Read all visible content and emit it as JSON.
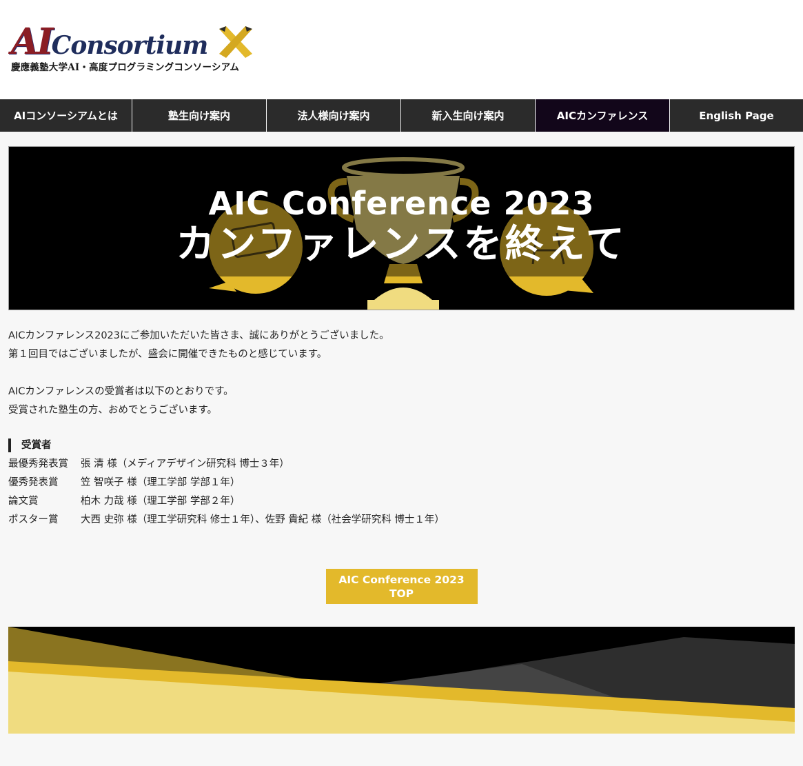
{
  "header": {
    "logo_ai": "AI",
    "logo_consortium": "Consortium",
    "logo_subtitle": "慶應義塾大学AI・高度プログラミングコンソーシアム"
  },
  "nav": {
    "items": [
      {
        "label": "AIコンソーシアムとは"
      },
      {
        "label": "塾生向け案内"
      },
      {
        "label": "法人様向け案内"
      },
      {
        "label": "新入生向け案内"
      },
      {
        "label": "AICカンファレンス"
      },
      {
        "label": "English Page"
      }
    ],
    "active_index": 4
  },
  "hero": {
    "title": "AIC Conference 2023",
    "subtitle": "カンファレンスを終えて"
  },
  "intro": {
    "p1": "AICカンファレンス2023にご参加いただいた皆さま、誠にありがとうございました。",
    "p2": "第１回目ではございましたが、盛会に開催できたものと感じています。",
    "p3": "AICカンファレンスの受賞者は以下のとおりです。",
    "p4": "受賞された塾生の方、おめでとうございます。"
  },
  "awards": {
    "heading": "受賞者",
    "rows": [
      {
        "category": "最優秀発表賞",
        "winners": "張 清 様（メディアデザイン研究科 博士３年）"
      },
      {
        "category": "優秀発表賞",
        "winners": "笠 智咲子 様（理工学部 学部１年）"
      },
      {
        "category": "論文賞",
        "winners": "柏木 力哉 様（理工学部 学部２年）"
      },
      {
        "category": "ポスター賞",
        "winners": "大西 史弥 様（理工学研究科 修士１年）、佐野 貴紀 様（社会学研究科 博士１年）"
      }
    ]
  },
  "top_button": {
    "line1": "AIC Conference 2023",
    "line2": "TOP"
  },
  "colors": {
    "accent_gold": "#e3b92b",
    "light_gold": "#f0dc80",
    "brand_red": "#8b1d24",
    "brand_navy": "#1f2d5c",
    "nav_bg": "#2b2b2b",
    "nav_active_bg": "#12061a"
  }
}
